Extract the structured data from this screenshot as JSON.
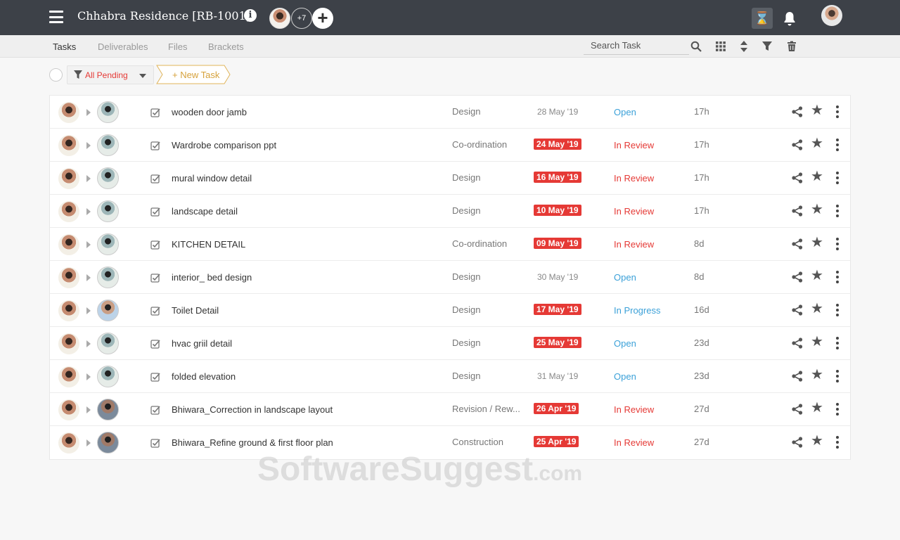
{
  "header": {
    "project_title": "Chhabra Residence [RB-1001]",
    "info_icon": "i",
    "member_count": "+7",
    "add_member": "+",
    "hourglass_icon": "⌛"
  },
  "tabs": [
    {
      "label": "Tasks",
      "active": true
    },
    {
      "label": "Deliverables",
      "active": false
    },
    {
      "label": "Files",
      "active": false
    },
    {
      "label": "Brackets",
      "active": false
    }
  ],
  "search": {
    "placeholder": "Search Task"
  },
  "filter": {
    "label": "All Pending"
  },
  "new_task": {
    "label": "+ New Task"
  },
  "tasks": [
    {
      "title": "wooden door jamb",
      "bracket": "Design",
      "due": "28 May '19",
      "overdue": false,
      "status": "Open",
      "status_type": "open",
      "duration": "17h",
      "assignee": "a"
    },
    {
      "title": "Wardrobe comparison ppt",
      "bracket": "Co-ordination",
      "due": "24 May '19",
      "overdue": true,
      "status": "In Review",
      "status_type": "review",
      "duration": "17h",
      "assignee": "a"
    },
    {
      "title": "mural window detail",
      "bracket": "Design",
      "due": "16 May '19",
      "overdue": true,
      "status": "In Review",
      "status_type": "review",
      "duration": "17h",
      "assignee": "a"
    },
    {
      "title": "landscape detail",
      "bracket": "Design",
      "due": "10 May '19",
      "overdue": true,
      "status": "In Review",
      "status_type": "review",
      "duration": "17h",
      "assignee": "a"
    },
    {
      "title": "KITCHEN DETAIL",
      "bracket": "Co-ordination",
      "due": "09 May '19",
      "overdue": true,
      "status": "In Review",
      "status_type": "review",
      "duration": "8d",
      "assignee": "a"
    },
    {
      "title": "interior_ bed design",
      "bracket": "Design",
      "due": "30 May '19",
      "overdue": false,
      "status": "Open",
      "status_type": "open",
      "duration": "8d",
      "assignee": "a"
    },
    {
      "title": "Toilet Detail",
      "bracket": "Design",
      "due": "17 May '19",
      "overdue": true,
      "status": "In Progress",
      "status_type": "progress",
      "duration": "16d",
      "assignee": "b"
    },
    {
      "title": "hvac griil detail",
      "bracket": "Design",
      "due": "25 May '19",
      "overdue": true,
      "status": "Open",
      "status_type": "open",
      "duration": "23d",
      "assignee": "a"
    },
    {
      "title": "folded elevation",
      "bracket": "Design",
      "due": "31 May '19",
      "overdue": false,
      "status": "Open",
      "status_type": "open",
      "duration": "23d",
      "assignee": "a"
    },
    {
      "title": "Bhiwara_Correction in landscape layout",
      "bracket": "Revision / Rew...",
      "due": "26 Apr '19",
      "overdue": true,
      "status": "In Review",
      "status_type": "review",
      "duration": "27d",
      "assignee": "c"
    },
    {
      "title": "Bhiwara_Refine ground & first floor plan",
      "bracket": "Construction",
      "due": "25 Apr '19",
      "overdue": true,
      "status": "In Review",
      "status_type": "review",
      "duration": "27d",
      "assignee": "c"
    }
  ],
  "watermark": {
    "main": "SoftwareSuggest",
    "suffix": ".com"
  },
  "colors": {
    "topbar": "#3d4148",
    "overdue": "#e53935",
    "open": "#3aa0d8",
    "accent": "#d6a23c"
  }
}
